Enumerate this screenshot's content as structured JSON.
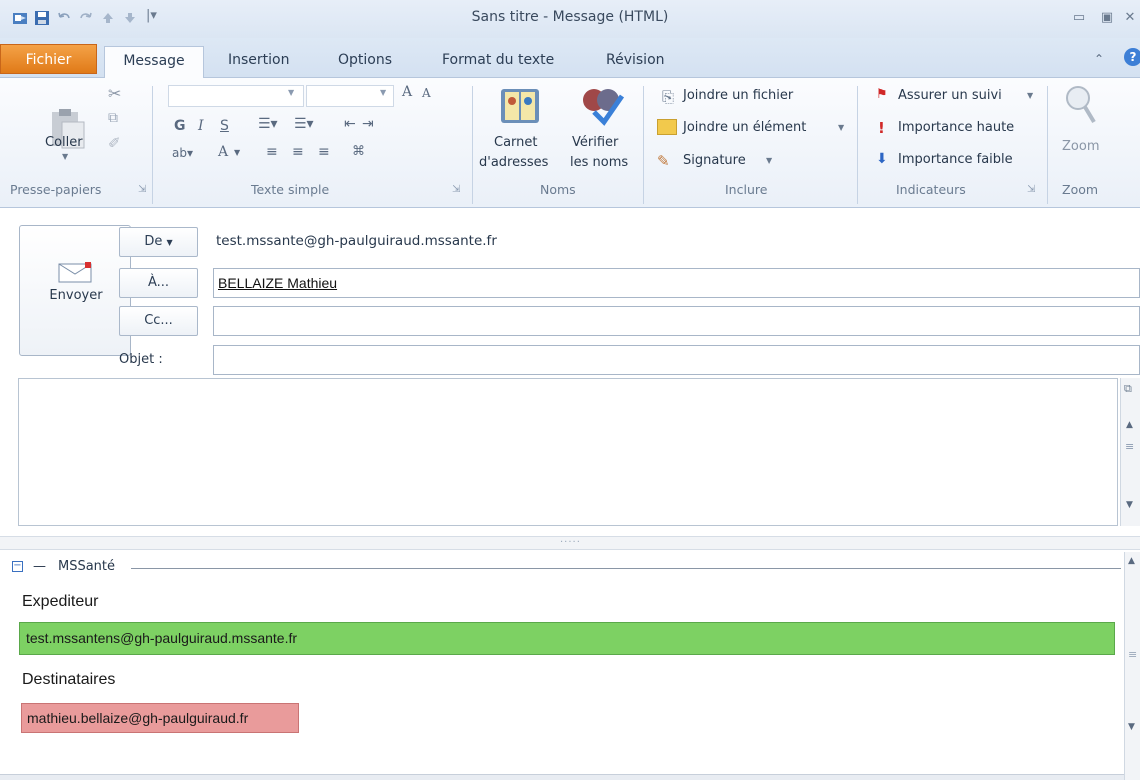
{
  "window": {
    "title": "Sans titre - Message (HTML)"
  },
  "tabs": [
    "Fichier",
    "Message",
    "Insertion",
    "Options",
    "Format du texte",
    "Révision"
  ],
  "ribbon": {
    "clipboard": {
      "paste": "Coller",
      "group": "Presse-papiers"
    },
    "basic_text": {
      "bold": "G",
      "italic": "I",
      "underline": "S",
      "font_grow": "A",
      "font_shrink": "A",
      "font_color": "A",
      "group": "Texte simple"
    },
    "names": {
      "address_book_line1": "Carnet",
      "address_book_line2": "d'adresses",
      "check_names_line1": "Vérifier",
      "check_names_line2": "les noms",
      "group": "Noms"
    },
    "include": {
      "attach_file": "Joindre un fichier",
      "attach_item": "Joindre un élément",
      "signature": "Signature",
      "group": "Inclure"
    },
    "tags": {
      "follow_up": "Assurer un suivi",
      "high_importance": "Importance haute",
      "low_importance": "Importance faible",
      "group": "Indicateurs"
    },
    "zoom": {
      "label": "Zoom",
      "group": "Zoom"
    }
  },
  "compose": {
    "send": "Envoyer",
    "from_label": "De",
    "from_value": "test.mssante@gh-paulguiraud.mssante.fr",
    "to_label": "À...",
    "to_value": "BELLAIZE Mathieu",
    "cc_label": "Cc...",
    "subject_label": "Objet :",
    "cc_value": "",
    "subject_value": "",
    "body": ""
  },
  "mssante": {
    "section_title": "MSSanté",
    "sender_label": "Expediteur",
    "sender_value": "test.mssantens@gh-paulguiraud.mssante.fr",
    "recipients_label": "Destinataires",
    "recipient_value": "mathieu.bellaize@gh-paulguiraud.fr"
  },
  "colors": {
    "file_tab": "#e88a2e",
    "sender_ok": "#7dd163",
    "recipient_warn": "#e99b9b"
  }
}
